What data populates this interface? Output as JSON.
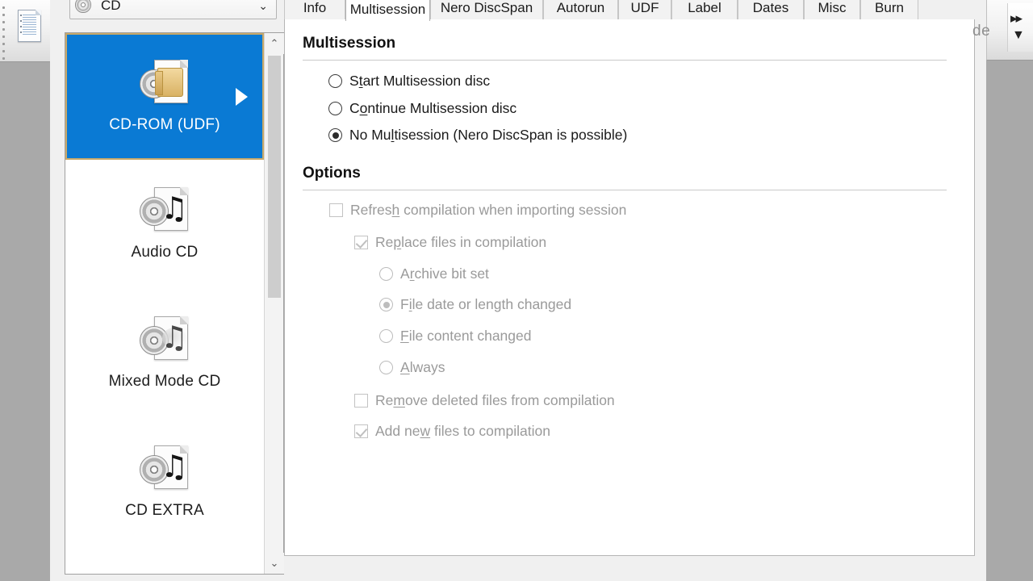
{
  "left_toolbar": {
    "doc_icon": "document-icon"
  },
  "right_toolbar": {
    "partial_text": "de",
    "glyph_fast_forward": "▸▸",
    "glyph_dropdown": "▼"
  },
  "media_selector": {
    "icon": "cd-disc-icon",
    "value": "CD",
    "arrow": "⌄"
  },
  "compilation_list": {
    "items": [
      {
        "label": "CD-ROM (UDF)",
        "icon": "cd-folder-document-icon",
        "selected": true,
        "has_submenu_arrow": true
      },
      {
        "label": "Audio CD",
        "icon": "cd-music-document-icon",
        "selected": false,
        "has_submenu_arrow": false
      },
      {
        "label": "Mixed Mode CD",
        "icon": "cd-music-document-icon",
        "selected": false,
        "has_submenu_arrow": false
      },
      {
        "label": "CD EXTRA",
        "icon": "cd-music-document-icon",
        "selected": false,
        "has_submenu_arrow": false
      }
    ],
    "scrollbar": {
      "up_glyph": "⌃",
      "down_glyph": "⌄"
    }
  },
  "tabs": [
    {
      "label": "Info",
      "active": false
    },
    {
      "label": "Multisession",
      "active": true
    },
    {
      "label": "Nero DiscSpan",
      "active": false
    },
    {
      "label": "Autorun",
      "active": false
    },
    {
      "label": "UDF",
      "active": false
    },
    {
      "label": "Label",
      "active": false
    },
    {
      "label": "Dates",
      "active": false
    },
    {
      "label": "Misc",
      "active": false
    },
    {
      "label": "Burn",
      "active": false
    }
  ],
  "multisession": {
    "title": "Multisession",
    "options": [
      {
        "pre": "S",
        "acc": "t",
        "post": "art Multisession disc",
        "label": "Start Multisession disc",
        "selected": false
      },
      {
        "pre": "C",
        "acc": "o",
        "post": "ntinue Multisession disc",
        "label": "Continue Multisession disc",
        "selected": false
      },
      {
        "pre": "No Mu",
        "acc": "l",
        "post": "tisession (Nero DiscSpan is possible)",
        "label": "No Multisession (Nero DiscSpan is possible)",
        "selected": true
      }
    ]
  },
  "options_group": {
    "title": "Options",
    "refresh": {
      "pre": "Refres",
      "acc": "h",
      "post": " compilation when importing session",
      "label": "Refresh compilation when importing session",
      "checked": false,
      "disabled": true
    },
    "replace": {
      "pre": "Re",
      "acc": "p",
      "post": "lace files in compilation",
      "label": "Replace files in compilation",
      "checked": true,
      "disabled": true
    },
    "replace_modes": [
      {
        "pre": "A",
        "acc": "r",
        "post": "chive bit set",
        "label": "Archive bit set",
        "selected": false,
        "disabled": true
      },
      {
        "pre": "F",
        "acc": "i",
        "post": "le date or length changed",
        "label": "File date or length changed",
        "selected": true,
        "disabled": true
      },
      {
        "pre": "",
        "acc": "F",
        "post": "ile content changed",
        "label": "File content changed",
        "selected": false,
        "disabled": true
      },
      {
        "pre": "",
        "acc": "A",
        "post": "lways",
        "label": "Always",
        "selected": false,
        "disabled": true
      }
    ],
    "remove": {
      "pre": "Re",
      "acc": "m",
      "post": "ove deleted files from compilation",
      "label": "Remove deleted files from compilation",
      "checked": false,
      "disabled": true
    },
    "add_new": {
      "pre": "Add ne",
      "acc": "w",
      "post": " files to compilation",
      "label": "Add new files to compilation",
      "checked": true,
      "disabled": true
    }
  },
  "colors": {
    "selection_blue": "#0a7ad4",
    "selection_border": "#c8a96a",
    "panel_bg": "#ffffff",
    "window_bg": "#f0f0f0",
    "desktop_bg": "#a9a9a9",
    "disabled_text": "#9a9a9a"
  }
}
